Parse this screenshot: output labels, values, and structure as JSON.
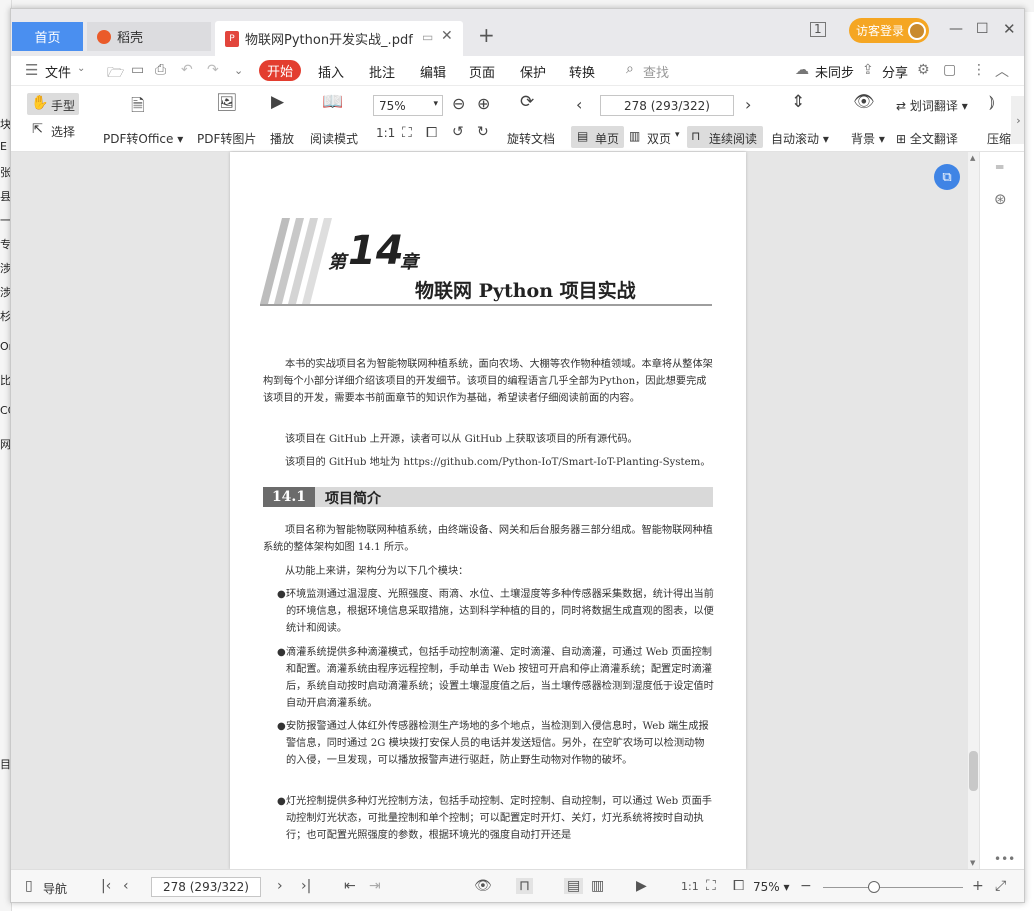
{
  "desktop_left_chars": [
    "块",
    "E",
    "张",
    "县",
    "一",
    "专",
    "涉",
    "涉",
    "杉",
    "On",
    "比",
    "CC",
    "网",
    "目"
  ],
  "tabs": {
    "home": "首页",
    "daoke": "稻壳",
    "doc": "物联网Python开发实战_.pdf",
    "add": "+"
  },
  "titlebar": {
    "visitor_login": "访客登录"
  },
  "menu": {
    "file": "文件",
    "start": "开始",
    "insert": "插入",
    "annotate": "批注",
    "edit": "编辑",
    "page": "页面",
    "protect": "保护",
    "convert": "转换",
    "search_placeholder": "查找",
    "unsync": "未同步",
    "share": "分享"
  },
  "ribbon": {
    "hand": "手型",
    "select": "选择",
    "pdf_to_office": "PDF转Office",
    "pdf_to_image": "PDF转图片",
    "play": "播放",
    "read_mode": "阅读模式",
    "zoom": "75%",
    "rotate_doc": "旋转文档",
    "page_number": "278 (293/322)",
    "single_page": "单页",
    "double_page": "双页",
    "continuous": "连续阅读",
    "auto_scroll": "自动滚动",
    "background": "背景",
    "word_translate": "划词翻译",
    "full_translate": "全文翻译",
    "compress": "压缩"
  },
  "document": {
    "chapter_prefix": "第",
    "chapter_number": "14",
    "chapter_suffix": "章",
    "chapter_title": "物联网 Python 项目实战",
    "intro1": "本书的实战项目名为智能物联网种植系统，面向农场、大棚等农作物种植领域。本章将从整体架构到每个小部分详细介绍该项目的开发细节。该项目的编程语言几乎全部为Python，因此想要完成该项目的开发，需要本书前面章节的知识作为基础，希望读者仔细阅读前面的内容。",
    "intro2": "该项目在 GitHub 上开源，读者可以从 GitHub 上获取该项目的所有源代码。",
    "intro3": "该项目的 GitHub 地址为 https://github.com/Python-IoT/Smart-IoT-Planting-System。",
    "section_number": "14.1",
    "section_title": "项目简介",
    "sec_p1": "项目名称为智能物联网种植系统，由终端设备、网关和后台服务器三部分组成。智能物联网种植系统的整体架构如图 14.1 所示。",
    "sec_p2": "从功能上来讲，架构分为以下几个模块：",
    "bullets": [
      "环境监测通过温湿度、光照强度、雨滴、水位、土壤湿度等多种传感器采集数据，统计得出当前的环境信息，根据环境信息采取措施，达到科学种植的目的，同时将数据生成直观的图表，以便统计和阅读。",
      "滴灌系统提供多种滴灌模式，包括手动控制滴灌、定时滴灌、自动滴灌，可通过 Web 页面控制和配置。滴灌系统由程序远程控制，手动单击 Web 按钮可开启和停止滴灌系统；配置定时滴灌后，系统自动按时启动滴灌系统；设置土壤湿度值之后，当土壤传感器检测到湿度低于设定值时自动开启滴灌系统。",
      "安防报警通过人体红外传感器检测生产场地的多个地点，当检测到入侵信息时，Web 端生成报警信息，同时通过 2G 模块拨打安保人员的电话并发送短信。另外，在空旷农场可以检测动物的入侵，一旦发现，可以播放报警声进行驱赶，防止野生动物对作物的破坏。",
      "灯光控制提供多种灯光控制方法，包括手动控制、定时控制、自动控制，可以通过 Web 页面手动控制灯光状态，可批量控制和单个控制；可以配置定时开灯、关灯，灯光系统将按时自动执行；也可配置光照强度的参数，根据环境光的强度自动打开还是"
    ]
  },
  "statusbar": {
    "nav": "导航",
    "page_number": "278 (293/322)",
    "zoom": "75%"
  },
  "colors": {
    "accent_blue": "#4a8ff0",
    "start_red": "#e33d2f",
    "visitor_orange": "#f5a623"
  }
}
